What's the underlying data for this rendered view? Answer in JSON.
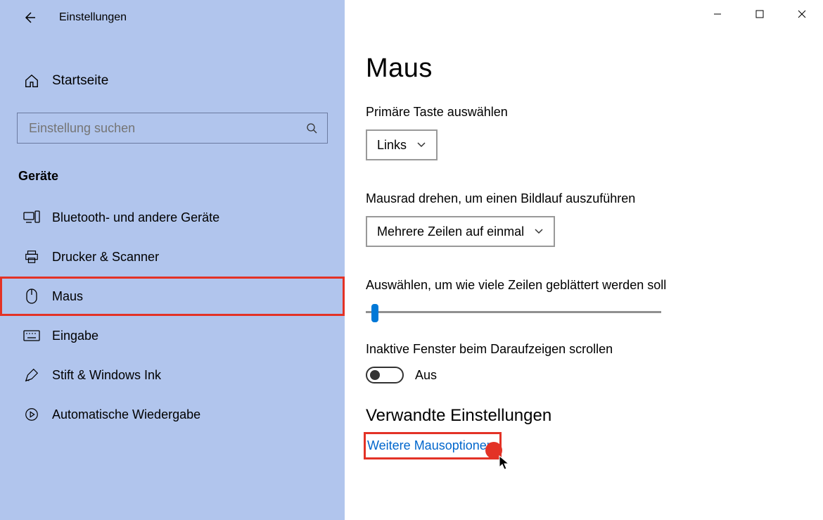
{
  "app": {
    "title": "Einstellungen"
  },
  "sidebar": {
    "home_label": "Startseite",
    "search_placeholder": "Einstellung suchen",
    "category_label": "Geräte",
    "items": [
      {
        "label": "Bluetooth- und andere Geräte"
      },
      {
        "label": "Drucker & Scanner"
      },
      {
        "label": "Maus"
      },
      {
        "label": "Eingabe"
      },
      {
        "label": "Stift & Windows Ink"
      },
      {
        "label": "Automatische Wiedergabe"
      }
    ]
  },
  "page": {
    "title": "Maus",
    "primary_button_label": "Primäre Taste auswählen",
    "primary_button_value": "Links",
    "scroll_mode_label": "Mausrad drehen, um einen Bildlauf auszuführen",
    "scroll_mode_value": "Mehrere Zeilen auf einmal",
    "scroll_lines_label": "Auswählen, um wie viele Zeilen geblättert werden soll",
    "hover_scroll_label": "Inaktive Fenster beim Daraufzeigen scrollen",
    "hover_scroll_value": "Aus",
    "related_heading": "Verwandte Einstellungen",
    "related_link": "Weitere Mausoptionen"
  }
}
